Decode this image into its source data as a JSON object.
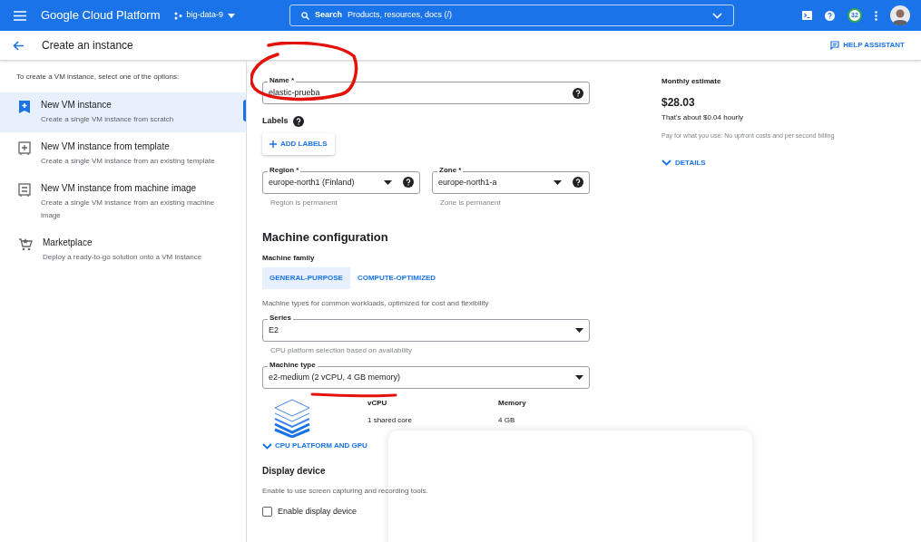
{
  "header": {
    "app_title": "Google Cloud Platform",
    "project": "big-data-9",
    "search": {
      "label": "Search",
      "placeholder": "Products, resources, docs (/)"
    },
    "notification_count": "32"
  },
  "page": {
    "title": "Create an instance",
    "help_button": "HELP ASSISTANT"
  },
  "sidebar": {
    "intro": "To create a VM instance, select one of the options:",
    "items": [
      {
        "kind": "new",
        "title": "New VM instance",
        "description": "Create a single VM instance from scratch",
        "selected": true
      },
      {
        "kind": "template",
        "title": "New VM instance from template",
        "description": "Create a single VM instance from an existing template",
        "selected": false
      },
      {
        "kind": "image",
        "title": "New VM instance from machine image",
        "description": "Create a single VM instance from an existing machine image",
        "selected": false
      },
      {
        "kind": "marketplace",
        "title": "Marketplace",
        "description": "Deploy a ready-to-go solution onto a VM instance",
        "selected": false
      }
    ]
  },
  "form": {
    "name": {
      "label": "Name *",
      "value": "elastic-prueba"
    },
    "labels": {
      "label": "Labels",
      "button": "ADD LABELS"
    },
    "region": {
      "label": "Region *",
      "value": "europe-north1 (Finland)",
      "hint": "Region is permanent"
    },
    "zone": {
      "label": "Zone *",
      "value": "europe-north1-a",
      "hint": "Zone is permanent"
    },
    "section_title": "Machine configuration",
    "machine_family": {
      "label": "Machine family",
      "tabs": [
        {
          "label": "GENERAL-PURPOSE",
          "selected": true
        },
        {
          "label": "COMPUTE-OPTIMIZED",
          "selected": false
        }
      ],
      "description": "Machine types for common workloads, optimized for cost and flexibility"
    },
    "series": {
      "label": "Series",
      "value": "E2",
      "hint": "CPU platform selection based on availability"
    },
    "machine_type": {
      "label": "Machine type",
      "value": "e2-medium (2 vCPU, 4 GB memory)"
    },
    "specs": [
      {
        "label": "vCPU",
        "value": "1 shared core"
      },
      {
        "label": "Memory",
        "value": "4 GB"
      }
    ],
    "cpu_platform_toggle": "CPU PLATFORM AND GPU",
    "display_device": {
      "title": "Display device",
      "description": "Enable to use screen capturing and recording tools.",
      "checkbox": {
        "label": "Enable display device",
        "checked": false
      }
    }
  },
  "estimate": {
    "label": "Monthly estimate",
    "price": "$28.03",
    "hourly": "That's about $0.04 hourly",
    "note": "Pay for what you use: No upfront costs and per second billing",
    "details": "DETAILS"
  }
}
